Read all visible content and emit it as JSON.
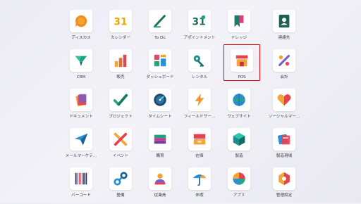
{
  "apps": [
    {
      "label": "ディスカス",
      "icon": "discuss-icon"
    },
    {
      "label": "カレンダー",
      "icon": "calendar-icon",
      "icon_text": "31"
    },
    {
      "label": "To Do",
      "icon": "todo-icon"
    },
    {
      "label": "アポイントメント",
      "icon": "appointment-icon",
      "icon_text": "31"
    },
    {
      "label": "ナレッジ",
      "icon": "knowledge-icon"
    },
    {
      "label": "連絡先",
      "icon": "contacts-icon"
    },
    {
      "label": "CRM",
      "icon": "crm-icon"
    },
    {
      "label": "販売",
      "icon": "sales-icon"
    },
    {
      "label": "ダッシュボード",
      "icon": "dashboard-icon"
    },
    {
      "label": "レンタル",
      "icon": "rental-icon"
    },
    {
      "label": "POS",
      "icon": "pos-icon"
    },
    {
      "label": "会計",
      "icon": "accounting-icon"
    },
    {
      "label": "ドキュメント",
      "icon": "documents-icon"
    },
    {
      "label": "プロジェクト",
      "icon": "project-icon"
    },
    {
      "label": "タイムシート",
      "icon": "timesheet-icon"
    },
    {
      "label": "フィールドサー...",
      "icon": "field-service-icon"
    },
    {
      "label": "ウェブサイト",
      "icon": "website-icon"
    },
    {
      "label": "ソーシャルマー...",
      "icon": "social-marketing-icon"
    },
    {
      "label": "メールマーケテ...",
      "icon": "email-marketing-icon"
    },
    {
      "label": "イベント",
      "icon": "events-icon"
    },
    {
      "label": "購買",
      "icon": "purchase-icon"
    },
    {
      "label": "在庫",
      "icon": "inventory-icon"
    },
    {
      "label": "製造",
      "icon": "manufacturing-icon"
    },
    {
      "label": "製造現場",
      "icon": "shop-floor-icon"
    },
    {
      "label": "バーコード",
      "icon": "barcode-icon"
    },
    {
      "label": "整備",
      "icon": "maintenance-icon"
    },
    {
      "label": "従業員",
      "icon": "employees-icon"
    },
    {
      "label": "休暇",
      "icon": "time-off-icon"
    },
    {
      "label": "アプリ",
      "icon": "apps-icon"
    },
    {
      "label": "管理設定",
      "icon": "settings-icon"
    }
  ],
  "selected_app": "POS",
  "colors": {
    "highlight": "#e10000",
    "background": "#efeef5"
  }
}
